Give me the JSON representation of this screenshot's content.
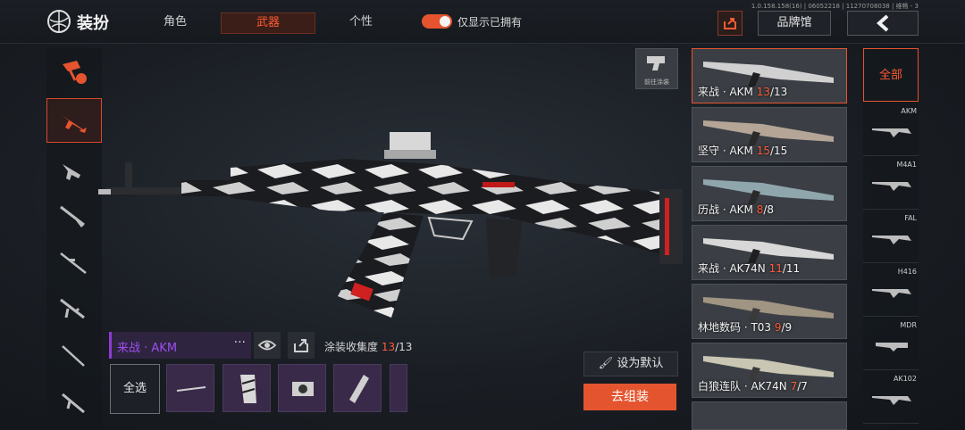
{
  "header": {
    "title": "装扮",
    "tabs": [
      {
        "label": "角色",
        "active": false
      },
      {
        "label": "武器",
        "active": true
      },
      {
        "label": "个性",
        "active": false
      }
    ],
    "toggle_label": "仅显示已拥有",
    "toggle_on": true,
    "version": "1.0.158.158(16) | 06052218 | 11270708038 | 维畅 - 3",
    "brand_label": "品牌馆"
  },
  "colors": {
    "accent": "#e5542f",
    "highlight": "#ff5a36",
    "purple": "#9c4df0"
  },
  "left_categories": [
    {
      "icon": "weapon-sale-icon",
      "active": false
    },
    {
      "icon": "assault-rifle-icon",
      "active": true
    },
    {
      "icon": "smg-icon",
      "active": false
    },
    {
      "icon": "shotgun-icon",
      "active": false
    },
    {
      "icon": "sniper-icon",
      "active": false
    },
    {
      "icon": "lmg-icon",
      "active": false
    },
    {
      "icon": "marksman-icon",
      "active": false
    },
    {
      "icon": "pistol-icon",
      "active": false
    }
  ],
  "preview": {
    "goto_paint_label": "前往涂装",
    "skin_name": "来战 · AKM",
    "collection_label": "涂装收集度",
    "collection_have": "13",
    "collection_total": "/13"
  },
  "parts": {
    "select_all": "全选"
  },
  "actions": {
    "set_default": "设为默认",
    "go_assemble": "去组装"
  },
  "skins": [
    {
      "name": "来战 · AKM ",
      "have": "13",
      "total": "/13",
      "active": true
    },
    {
      "name": "坚守 · AKM ",
      "have": "15",
      "total": "/15",
      "active": false
    },
    {
      "name": "历战 · AKM ",
      "have": "8",
      "total": "/8",
      "active": false
    },
    {
      "name": "来战 · AK74N ",
      "have": "11",
      "total": "/11",
      "active": false
    },
    {
      "name": "林地数码 · T03 ",
      "have": "9",
      "total": "/9",
      "active": false
    },
    {
      "name": "白狼连队 · AK74N ",
      "have": "7",
      "total": "/7",
      "active": false
    }
  ],
  "weapon_filter": {
    "all_label": "全部",
    "guns": [
      "AKM",
      "M4A1",
      "FAL",
      "H416",
      "MDR",
      "AK102"
    ]
  }
}
